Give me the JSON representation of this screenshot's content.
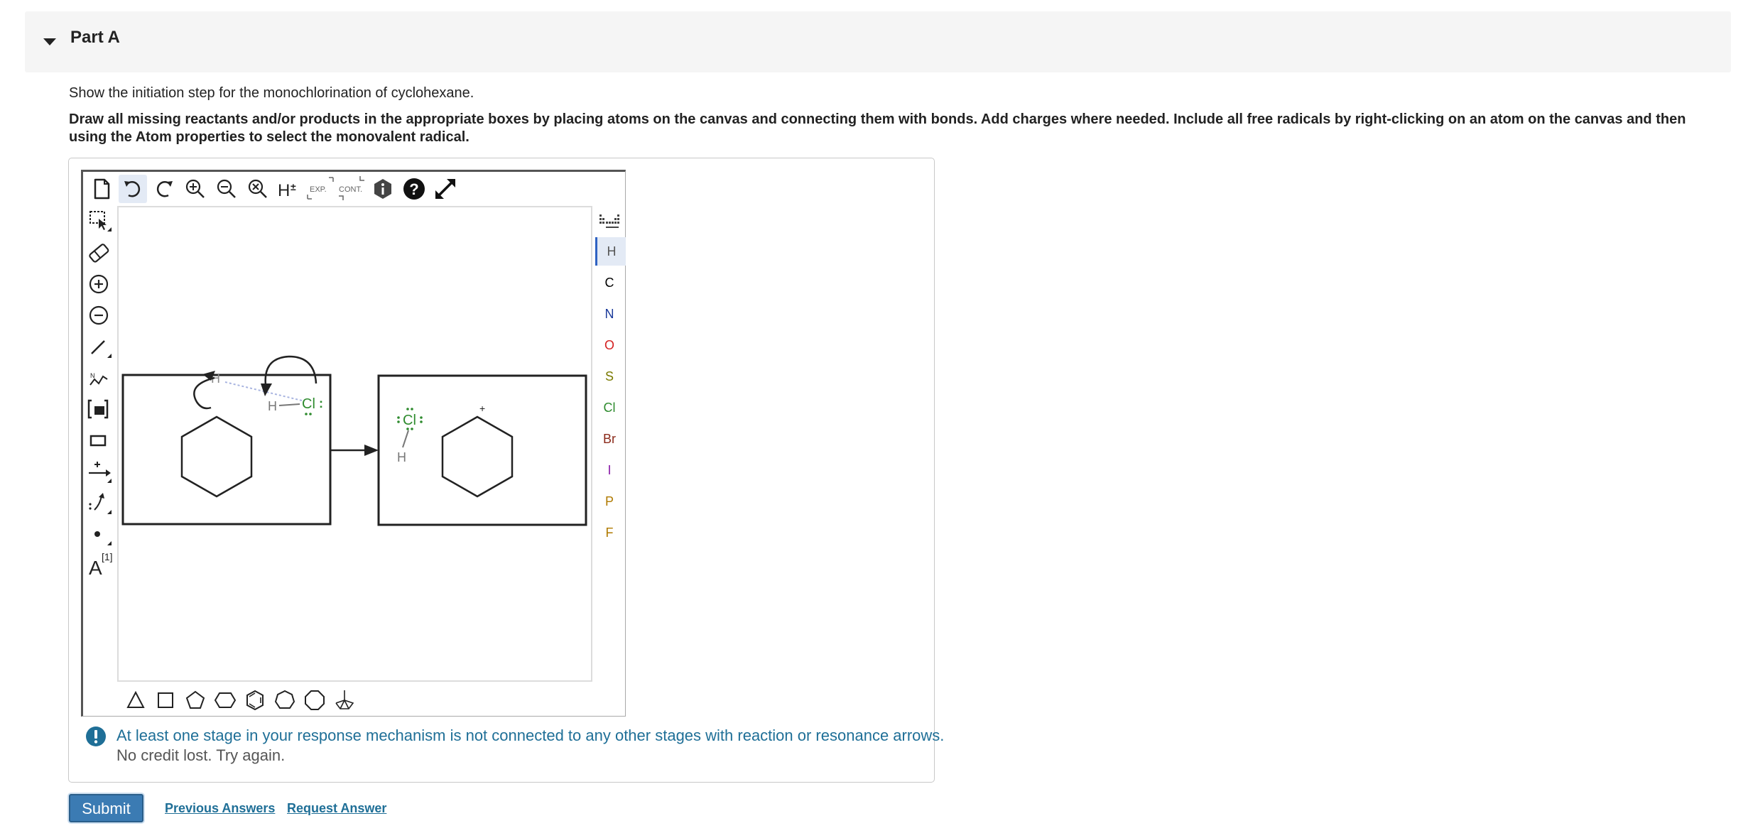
{
  "part": {
    "title": "Part A"
  },
  "prompt": "Show the initiation step for the monochlorination of cyclohexane.",
  "instructions": "Draw all missing reactants and/or products in the appropriate boxes by placing atoms on the canvas and connecting them with bonds. Add charges where needed. Include all free radicals by right-clicking on an atom on the canvas and then using the Atom properties to select the monovalent radical.",
  "toolbar": {
    "top": [
      {
        "name": "new-document",
        "icon": "document-icon"
      },
      {
        "name": "undo",
        "icon": "undo-icon"
      },
      {
        "name": "redo",
        "icon": "redo-icon"
      },
      {
        "name": "zoom-in",
        "icon": "zoom-in-icon"
      },
      {
        "name": "zoom-out",
        "icon": "zoom-out-icon"
      },
      {
        "name": "zoom-reset",
        "icon": "zoom-reset-icon"
      },
      {
        "name": "toggle-hydrogens",
        "icon": "h-plus-minus-icon"
      },
      {
        "name": "expand",
        "icon": "exp-icon",
        "label": "EXP."
      },
      {
        "name": "contract",
        "icon": "cont-icon",
        "label": "CONT."
      },
      {
        "name": "info",
        "icon": "info-hexagon-icon"
      },
      {
        "name": "help",
        "icon": "help-icon"
      },
      {
        "name": "fullscreen",
        "icon": "fullscreen-icon"
      }
    ],
    "left": [
      "select-lasso-icon",
      "eraser-icon",
      "charge-plus-icon",
      "charge-minus-icon",
      "single-bond-icon",
      "chain-icon",
      "bracket-icon",
      "rectangle-icon",
      "reaction-arrow-icon",
      "electron-arrow-icon",
      "radical-dot-icon",
      "text-atom-icon"
    ],
    "text_label": "A",
    "text_superscript": "[1]"
  },
  "periodic_table": {
    "elements": [
      {
        "symbol": "H",
        "color": "#555555",
        "selected": true
      },
      {
        "symbol": "C",
        "color": "#000000"
      },
      {
        "symbol": "N",
        "color": "#1a3a9a"
      },
      {
        "symbol": "O",
        "color": "#d42020"
      },
      {
        "symbol": "S",
        "color": "#7a7a00"
      },
      {
        "symbol": "Cl",
        "color": "#2e8b2e"
      },
      {
        "symbol": "Br",
        "color": "#8b2a1a"
      },
      {
        "symbol": "I",
        "color": "#8a1aa8"
      },
      {
        "symbol": "P",
        "color": "#b07a00"
      },
      {
        "symbol": "F",
        "color": "#b07a00"
      }
    ]
  },
  "canvas": {
    "reactant_box": {
      "atoms": [
        "H",
        "H",
        "Cl"
      ],
      "lone_pair_dots": ":"
    },
    "product_box": {
      "atoms": [
        "Cl",
        "H"
      ],
      "charge": "+"
    }
  },
  "bottom_shapes": [
    "triangle-icon",
    "square-icon",
    "pentagon-icon",
    "hexagon-icon",
    "benzene-icon",
    "heptagon-icon",
    "octagon-icon",
    "chair-icon"
  ],
  "feedback": {
    "message": "At least one stage in your response mechanism is not connected to any other stages with reaction or resonance arrows.",
    "sub": "No credit lost. Try again."
  },
  "actions": {
    "submit": "Submit",
    "previous_answers": "Previous Answers",
    "request_answer": "Request Answer"
  },
  "colors": {
    "accent": "#3b7bb3",
    "link": "#1f6f97",
    "chlorine": "#2e8b2e",
    "header_bg": "#f5f5f5"
  }
}
